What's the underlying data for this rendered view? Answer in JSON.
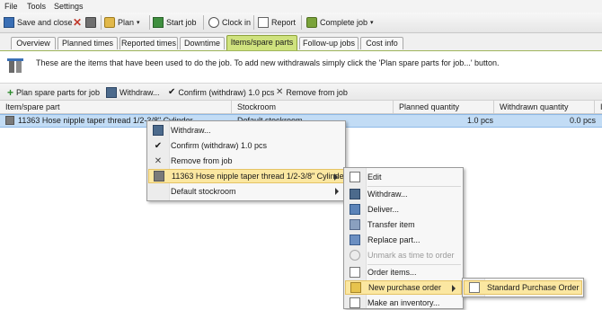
{
  "menubar": {
    "items": [
      "File",
      "Tools",
      "Settings"
    ]
  },
  "toolbar": {
    "save_close": "Save and close",
    "plan": "Plan",
    "start_job": "Start job",
    "clock_in": "Clock in",
    "report": "Report",
    "complete_job": "Complete job"
  },
  "tabs": [
    "Overview",
    "Planned times",
    "Reported times",
    "Downtime",
    "Items/spare parts",
    "Follow-up jobs",
    "Cost info"
  ],
  "active_tab": "Items/spare parts",
  "info_text": "These are the items that have been used to do the job. To add new withdrawals simply click the 'Plan spare parts for job...' button.",
  "actions": {
    "plan_spare_parts": "Plan spare parts for job",
    "withdraw": "Withdraw...",
    "confirm_withdraw": "Confirm (withdraw) 1.0 pcs",
    "remove": "Remove from job"
  },
  "grid": {
    "columns": [
      "Item/spare part",
      "Stockroom",
      "Planned quantity",
      "Withdrawn quantity",
      "I"
    ],
    "rows": [
      {
        "item": "11363 Hose nipple taper thread 1/2-3/8\" Cylinder",
        "stockroom": "Default stockroom",
        "planned": "1.0 pcs",
        "withdrawn": "0.0 pcs"
      }
    ]
  },
  "context_menu": {
    "items": [
      {
        "label": "Withdraw...",
        "icon": "withdraw-icon"
      },
      {
        "label": "Confirm (withdraw) 1.0 pcs",
        "icon": "check-icon"
      },
      {
        "label": "Remove from job",
        "icon": "remove-icon"
      },
      {
        "label": "11363 Hose nipple taper thread 1/2-3/8\" Cylinder",
        "icon": "item-icon",
        "submenu": true
      },
      {
        "label": "Default stockroom",
        "submenu": true
      }
    ]
  },
  "item_submenu": {
    "items": [
      {
        "label": "Edit",
        "icon": "edit-icon"
      },
      {
        "label": "Withdraw...",
        "icon": "withdraw-icon"
      },
      {
        "label": "Deliver...",
        "icon": "deliver-icon"
      },
      {
        "label": "Transfer item",
        "icon": "transfer-icon"
      },
      {
        "label": "Replace part...",
        "icon": "replace-icon"
      },
      {
        "label": "Unmark as time to order",
        "icon": "clock-icon",
        "disabled": true
      },
      {
        "label": "Order items...",
        "icon": "order-icon"
      },
      {
        "label": "New purchase order",
        "icon": "purchase-order-icon",
        "submenu": true
      },
      {
        "label": "Make an inventory...",
        "icon": "inventory-icon"
      }
    ]
  },
  "purchase_submenu": {
    "items": [
      {
        "label": "Standard Purchase Order",
        "icon": "document-icon"
      }
    ]
  },
  "colors": {
    "accent_green": "#cfe27e",
    "selection_blue": "#c2dcf5",
    "menu_highlight": "#fbe7a1",
    "remove_red": "#c0392b"
  }
}
